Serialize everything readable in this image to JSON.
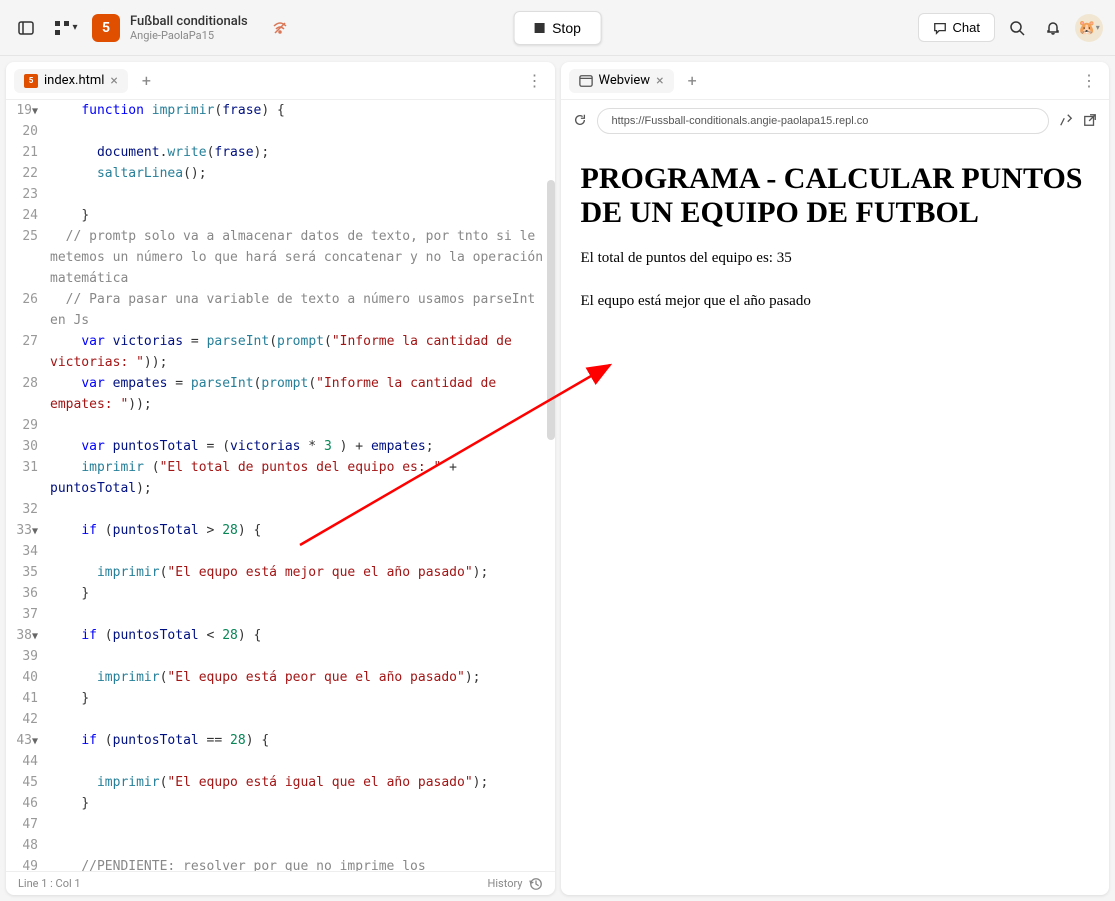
{
  "header": {
    "project_title": "Fußball conditionals",
    "project_author": "Angie-PaolaPa15",
    "stop_label": "Stop",
    "chat_label": "Chat"
  },
  "editor": {
    "tab_name": "index.html",
    "status_left": "Line 1 : Col 1",
    "status_right": "History",
    "lines": [
      {
        "n": "19",
        "fold": "▼",
        "indent": 2,
        "tokens": [
          {
            "t": "kw",
            "v": "function"
          },
          {
            "t": "op",
            "v": " "
          },
          {
            "t": "fn",
            "v": "imprimir"
          },
          {
            "t": "op",
            "v": "("
          },
          {
            "t": "var",
            "v": "frase"
          },
          {
            "t": "op",
            "v": ") {"
          }
        ]
      },
      {
        "n": "20",
        "indent": 2,
        "tokens": []
      },
      {
        "n": "21",
        "indent": 3,
        "tokens": [
          {
            "t": "var",
            "v": "document"
          },
          {
            "t": "op",
            "v": "."
          },
          {
            "t": "fn",
            "v": "write"
          },
          {
            "t": "op",
            "v": "("
          },
          {
            "t": "var",
            "v": "frase"
          },
          {
            "t": "op",
            "v": ");"
          }
        ]
      },
      {
        "n": "22",
        "indent": 3,
        "tokens": [
          {
            "t": "fn",
            "v": "saltarLinea"
          },
          {
            "t": "op",
            "v": "();"
          }
        ]
      },
      {
        "n": "23",
        "indent": 2,
        "tokens": []
      },
      {
        "n": "24",
        "indent": 2,
        "tokens": [
          {
            "t": "op",
            "v": "}"
          }
        ]
      },
      {
        "n": "25",
        "indent": 0,
        "wrap": true,
        "tokens": [
          {
            "t": "op",
            "v": "  "
          },
          {
            "t": "cmt",
            "v": "// promtp solo va a almacenar datos de texto, por tnto si le metemos un número lo que hará será concatenar y no la operación matemática"
          }
        ]
      },
      {
        "n": "26",
        "indent": 0,
        "wrap": true,
        "tokens": [
          {
            "t": "op",
            "v": "  "
          },
          {
            "t": "cmt",
            "v": "// Para pasar una variable de texto a número usamos parseInt en Js"
          }
        ]
      },
      {
        "n": "27",
        "indent": 2,
        "wrap": true,
        "tokens": [
          {
            "t": "kw",
            "v": "var"
          },
          {
            "t": "op",
            "v": " "
          },
          {
            "t": "var",
            "v": "victorias"
          },
          {
            "t": "op",
            "v": " = "
          },
          {
            "t": "fn",
            "v": "parseInt"
          },
          {
            "t": "op",
            "v": "("
          },
          {
            "t": "fn",
            "v": "prompt"
          },
          {
            "t": "op",
            "v": "("
          },
          {
            "t": "str",
            "v": "\"Informe la cantidad de victorias: \""
          },
          {
            "t": "op",
            "v": "));"
          }
        ],
        "wrapPrefix": ""
      },
      {
        "n": "28",
        "indent": 2,
        "wrap": true,
        "tokens": [
          {
            "t": "kw",
            "v": "var"
          },
          {
            "t": "op",
            "v": " "
          },
          {
            "t": "var",
            "v": "empates"
          },
          {
            "t": "op",
            "v": " = "
          },
          {
            "t": "fn",
            "v": "parseInt"
          },
          {
            "t": "op",
            "v": "("
          },
          {
            "t": "fn",
            "v": "prompt"
          },
          {
            "t": "op",
            "v": "("
          },
          {
            "t": "str",
            "v": "\"Informe la cantidad de empates: \""
          },
          {
            "t": "op",
            "v": "));"
          }
        ]
      },
      {
        "n": "29",
        "indent": 2,
        "tokens": []
      },
      {
        "n": "30",
        "indent": 2,
        "tokens": [
          {
            "t": "kw",
            "v": "var"
          },
          {
            "t": "op",
            "v": " "
          },
          {
            "t": "var",
            "v": "puntosTotal"
          },
          {
            "t": "op",
            "v": " = ("
          },
          {
            "t": "var",
            "v": "victorias"
          },
          {
            "t": "op",
            "v": " * "
          },
          {
            "t": "num",
            "v": "3"
          },
          {
            "t": "op",
            "v": " ) + "
          },
          {
            "t": "var",
            "v": "empates"
          },
          {
            "t": "op",
            "v": ";"
          }
        ]
      },
      {
        "n": "31",
        "indent": 2,
        "wrap": true,
        "tokens": [
          {
            "t": "fn",
            "v": "imprimir"
          },
          {
            "t": "op",
            "v": " ("
          },
          {
            "t": "str",
            "v": "\"El total de puntos del equipo es: \""
          },
          {
            "t": "op",
            "v": " + "
          },
          {
            "t": "var",
            "v": "puntosTotal"
          },
          {
            "t": "op",
            "v": ");"
          }
        ]
      },
      {
        "n": "32",
        "indent": 2,
        "tokens": []
      },
      {
        "n": "33",
        "fold": "▼",
        "indent": 2,
        "tokens": [
          {
            "t": "kw",
            "v": "if"
          },
          {
            "t": "op",
            "v": " ("
          },
          {
            "t": "var",
            "v": "puntosTotal"
          },
          {
            "t": "op",
            "v": " > "
          },
          {
            "t": "num",
            "v": "28"
          },
          {
            "t": "op",
            "v": ") {"
          }
        ]
      },
      {
        "n": "34",
        "indent": 2,
        "tokens": []
      },
      {
        "n": "35",
        "indent": 3,
        "tokens": [
          {
            "t": "fn",
            "v": "imprimir"
          },
          {
            "t": "op",
            "v": "("
          },
          {
            "t": "str",
            "v": "\"El equpo está mejor que el año pasado\""
          },
          {
            "t": "op",
            "v": ");"
          }
        ]
      },
      {
        "n": "36",
        "indent": 2,
        "tokens": [
          {
            "t": "op",
            "v": "}"
          }
        ]
      },
      {
        "n": "37",
        "indent": 2,
        "tokens": []
      },
      {
        "n": "38",
        "fold": "▼",
        "indent": 2,
        "tokens": [
          {
            "t": "kw",
            "v": "if"
          },
          {
            "t": "op",
            "v": " ("
          },
          {
            "t": "var",
            "v": "puntosTotal"
          },
          {
            "t": "op",
            "v": " < "
          },
          {
            "t": "num",
            "v": "28"
          },
          {
            "t": "op",
            "v": ") {"
          }
        ]
      },
      {
        "n": "39",
        "indent": 2,
        "tokens": []
      },
      {
        "n": "40",
        "indent": 3,
        "tokens": [
          {
            "t": "fn",
            "v": "imprimir"
          },
          {
            "t": "op",
            "v": "("
          },
          {
            "t": "str",
            "v": "\"El equpo está peor que el año pasado\""
          },
          {
            "t": "op",
            "v": ");"
          }
        ]
      },
      {
        "n": "41",
        "indent": 2,
        "tokens": [
          {
            "t": "op",
            "v": "}"
          }
        ]
      },
      {
        "n": "42",
        "indent": 2,
        "tokens": []
      },
      {
        "n": "43",
        "fold": "▼",
        "indent": 2,
        "tokens": [
          {
            "t": "kw",
            "v": "if"
          },
          {
            "t": "op",
            "v": " ("
          },
          {
            "t": "var",
            "v": "puntosTotal"
          },
          {
            "t": "op",
            "v": " == "
          },
          {
            "t": "num",
            "v": "28"
          },
          {
            "t": "op",
            "v": ") {"
          }
        ]
      },
      {
        "n": "44",
        "indent": 2,
        "tokens": []
      },
      {
        "n": "45",
        "indent": 3,
        "tokens": [
          {
            "t": "fn",
            "v": "imprimir"
          },
          {
            "t": "op",
            "v": "("
          },
          {
            "t": "str",
            "v": "\"El equpo está igual que el año pasado\""
          },
          {
            "t": "op",
            "v": ");"
          }
        ]
      },
      {
        "n": "46",
        "indent": 2,
        "tokens": [
          {
            "t": "op",
            "v": "}"
          }
        ]
      },
      {
        "n": "47",
        "indent": 2,
        "tokens": []
      },
      {
        "n": "48",
        "indent": 2,
        "tokens": []
      },
      {
        "n": "49",
        "indent": 2,
        "tokens": [
          {
            "t": "cmt",
            "v": "//PENDIENTE: resolver por que no imprime los"
          }
        ]
      }
    ]
  },
  "webview": {
    "tab_name": "Webview",
    "url": "https://Fussball-conditionals.angie-paolapa15.repl.co",
    "heading": "PROGRAMA - CALCULAR PUNTOS DE UN EQUIPO DE FUTBOL",
    "line1": "El total de puntos del equipo es: 35",
    "line2": "El equpo está mejor que el año pasado"
  }
}
